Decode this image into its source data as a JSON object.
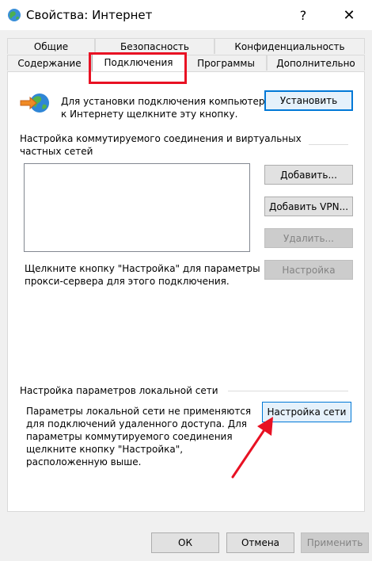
{
  "window": {
    "title": "Свойства: Интернет",
    "help_glyph": "?",
    "close_glyph": "✕"
  },
  "tabs": {
    "row1": [
      "Общие",
      "Безопасность",
      "Конфиденциальность"
    ],
    "row2": [
      "Содержание",
      "Подключения",
      "Программы",
      "Дополнительно"
    ],
    "active": "Подключения"
  },
  "setup": {
    "text_line1": "Для установки подключения компьютера",
    "text_line2": "к Интернету щелкните эту кнопку.",
    "install_label": "Установить"
  },
  "dialup": {
    "heading_line1": "Настройка коммутируемого соединения и виртуальных",
    "heading_line2": "частных сетей",
    "add_label": "Добавить...",
    "add_vpn_label": "Добавить VPN...",
    "remove_label": "Удалить...",
    "settings_label": "Настройка",
    "proxy_line1": "Щелкните кнопку \"Настройка\" для параметры",
    "proxy_line2": "прокси-сервера для этого подключения."
  },
  "lan": {
    "heading": "Настройка параметров локальной сети",
    "text_lines": [
      "Параметры локальной сети не применяются",
      "для подключений удаленного доступа. Для",
      "параметры коммутируемого соединения",
      "щелкните кнопку \"Настройка\",",
      "расположенную выше."
    ],
    "lan_settings_label": "Настройка сети"
  },
  "footer": {
    "ok_label": "ОК",
    "cancel_label": "Отмена",
    "apply_label": "Применить"
  },
  "colors": {
    "annotation": "#e81123",
    "focus_border": "#0078d7"
  },
  "icons": {
    "app": "globe-icon",
    "setup": "globe-arrow-icon"
  }
}
